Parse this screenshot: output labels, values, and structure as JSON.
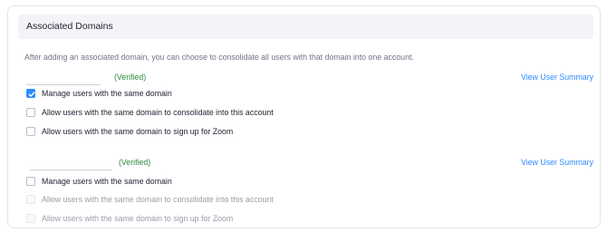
{
  "section": {
    "title": "Associated Domains",
    "description": "After adding an associated domain, you can choose to consolidate all users with that domain into one account."
  },
  "domains": [
    {
      "domain_value": "",
      "status": "(Verified)",
      "link": "View User Summary",
      "options": [
        {
          "label": "Manage users with the same domain",
          "checked": true,
          "disabled": false
        },
        {
          "label": "Allow users with the same domain to consolidate into this account",
          "checked": false,
          "disabled": false
        },
        {
          "label": "Allow users with the same domain to sign up for Zoom",
          "checked": false,
          "disabled": false
        }
      ]
    },
    {
      "domain_value": "",
      "status": "(Verified)",
      "link": "View User Summary",
      "options": [
        {
          "label": "Manage users with the same domain",
          "checked": false,
          "disabled": false
        },
        {
          "label": "Allow users with the same domain to consolidate into this account",
          "checked": false,
          "disabled": true
        },
        {
          "label": "Allow users with the same domain to sign up for Zoom",
          "checked": false,
          "disabled": true
        }
      ]
    }
  ],
  "colors": {
    "accent": "#2d8cff",
    "verified": "#2d8a3e",
    "header_bg": "#f3f4f7"
  }
}
